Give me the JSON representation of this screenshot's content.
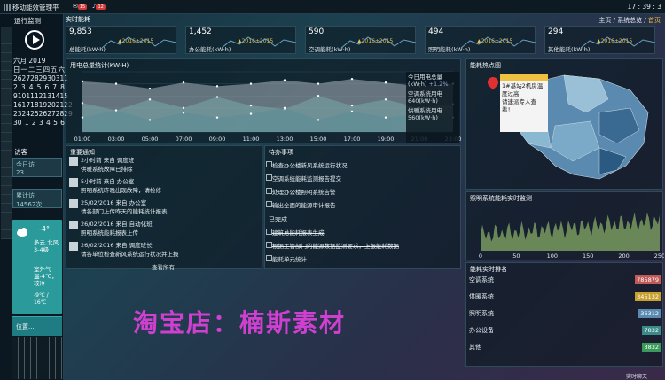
{
  "app": {
    "title": "移动能效管理平",
    "badge_count": "15",
    "badge_count2": "12",
    "time": "17 : 39 : 3"
  },
  "sidebar": {
    "title": "运行监测",
    "calendar": {
      "month": "六月 2019",
      "weekdays": [
        "日",
        "一",
        "二",
        "三",
        "四",
        "五",
        "六"
      ],
      "rows": [
        [
          "26",
          "27",
          "28",
          "29",
          "30",
          "31",
          "1"
        ],
        [
          "2",
          "3",
          "4",
          "5",
          "6",
          "7",
          "8"
        ],
        [
          "9",
          "10",
          "11",
          "12",
          "13",
          "14",
          "15"
        ],
        [
          "16",
          "17",
          "18",
          "19",
          "20",
          "21",
          "22"
        ],
        [
          "23",
          "24",
          "25",
          "26",
          "27",
          "28",
          "29"
        ],
        [
          "30",
          "1",
          "2",
          "3",
          "4",
          "5",
          "6"
        ]
      ]
    },
    "visitors_label": "访客",
    "today_visits_label": "今日访",
    "today_visits": "23",
    "total_visits_label": "累计访",
    "total_visits": "14562次",
    "weather": {
      "temp": "-4°",
      "desc": "多云,北风3-4级",
      "room_label": "室外气温-4℃，较冷",
      "range": "-9℃ / 16℃"
    },
    "location_label": "位置..."
  },
  "header": {
    "realtime_label": "实时能耗",
    "breadcrumb": [
      "主页",
      "系统总览",
      "首页"
    ]
  },
  "kpis": [
    {
      "value": "9,853",
      "label": "总能耗(kW·h)",
      "tag": "▲2016+2015"
    },
    {
      "value": "1,452",
      "label": "办公能耗(kW·h)",
      "tag": "▲2016+2015"
    },
    {
      "value": "590",
      "label": "空调能耗(kW·h)",
      "tag": "▲2016+2015"
    },
    {
      "value": "494",
      "label": "照明能耗(kW·h)",
      "tag": "▲2016+2015"
    },
    {
      "value": "294",
      "label": "其他能耗(kW·h)",
      "tag": "▲2016+2015"
    }
  ],
  "usage_panel": {
    "title": "用电总量统计(KW·H)",
    "overlay": {
      "today_label": "今日用电总量",
      "unit": "(kW·h)",
      "change": "+1.2%",
      "ac_label": "空调系统用电",
      "ac_value": "640(kW·h)",
      "heat_label": "供暖系统用电",
      "heat_value": "560(kW·h)"
    }
  },
  "chart_data": {
    "type": "area",
    "title": "用电总量统计(KW·H)",
    "x": [
      "01:00",
      "03:00",
      "05:00",
      "07:00",
      "09:00",
      "11:00",
      "13:00",
      "15:00",
      "17:00",
      "19:00",
      "21:00",
      "23:00"
    ],
    "ylim": [
      0,
      2500
    ],
    "series": [
      {
        "values": [
          2100,
          2000,
          1800,
          2050,
          1900,
          2000,
          2150,
          2000,
          2200,
          2050,
          1900,
          2000
        ]
      },
      {
        "values": [
          1200,
          900,
          1350,
          1000,
          1450,
          1100,
          950,
          1500,
          1100,
          1350,
          1000,
          1150
        ]
      },
      {
        "values": [
          600,
          900,
          500,
          800,
          600,
          750,
          1000,
          500,
          850,
          600,
          750,
          600
        ]
      }
    ]
  },
  "notices": {
    "title": "重要通知",
    "items": [
      {
        "time": "2小时前 来自 调度班",
        "text": "供暖系统故障已排除"
      },
      {
        "time": "5小时前 来自 办公室",
        "text": "照明系统昨晚出现故障，请检修"
      },
      {
        "time": "25/02/2016 来自 办公室",
        "text": "请各部门上传昨天的能耗统计报表"
      },
      {
        "time": "26/02/2016 来自 自动化班",
        "text": "照明系统能耗报表上传"
      },
      {
        "time": "26/02/2016 来自 调度班长",
        "text": "请各单位检查新风系统运行状况并上报"
      }
    ],
    "view_all": "查看所有"
  },
  "todos": {
    "title": "待办事项",
    "pending": [
      "检查办公楼新风系统运行状况",
      "空调系统能耗监测报告提交",
      "处理办公楼照明系统告警",
      "输出全面的能源审计报告"
    ],
    "done_title": "已完成",
    "done": [
      "建筑总能耗报表生成",
      "根据主管部门的能源数据监测要求，上报能耗数据",
      "能耗单元统计"
    ]
  },
  "map_panel": {
    "title": "能耗热点图",
    "popup_lines": [
      "1#基站2机房温",
      "度过高",
      "请速派专人查",
      "看！"
    ]
  },
  "lighting_panel": {
    "title": "照明系统能耗实时监测",
    "x_ticks": [
      "0",
      "50",
      "100",
      "150",
      "200",
      "250"
    ]
  },
  "ranking": {
    "title": "能耗实时排名",
    "items": [
      {
        "label": "空调系统",
        "value": "785879",
        "color": "#c05a5a"
      },
      {
        "label": "供暖系统",
        "value": "345132",
        "color": "#c8a030"
      },
      {
        "label": "照明系统",
        "value": "36312",
        "color": "#5a8ab0"
      },
      {
        "label": "办公设备",
        "value": "7832",
        "color": "#3a8a8a"
      },
      {
        "label": "其他",
        "value": "3832",
        "color": "#3a9a5a"
      }
    ]
  },
  "footer": {
    "status": "实时聊天"
  },
  "watermark": "淘宝店：楠斯素材"
}
